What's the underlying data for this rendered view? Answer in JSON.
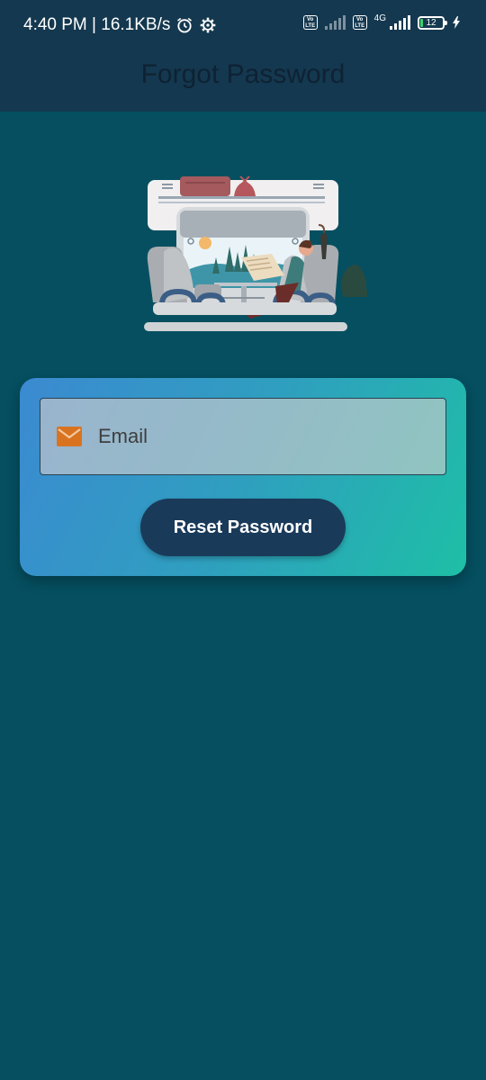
{
  "status_bar": {
    "time_speed": "4:40 PM | 16.1KB/s",
    "network_label": "4G",
    "battery_level": "12",
    "icons": [
      "alarm-icon",
      "gear-icon",
      "volte-icon",
      "signal-icon",
      "battery-icon",
      "charging-icon"
    ]
  },
  "app_bar": {
    "title": "Forgot Password"
  },
  "form": {
    "email_placeholder": "Email",
    "email_value": "",
    "reset_button_label": "Reset Password"
  },
  "colors": {
    "background": "#054f60",
    "app_bar": "#14384f",
    "button": "#1a3a5a",
    "mail_icon": "#d9731f"
  }
}
